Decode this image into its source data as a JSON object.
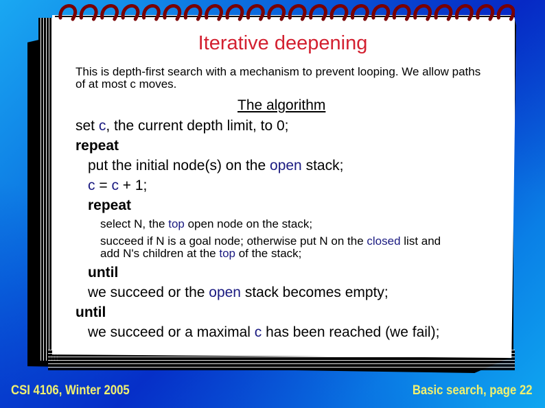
{
  "slide": {
    "title": "Iterative deepening",
    "intro": "This is depth-first search with a mechanism to prevent looping. We allow paths of at most c moves.",
    "subheading": "The algorithm",
    "algorithm": {
      "l1": {
        "a": "set ",
        "b": "c",
        "c": ", the current depth limit, to 0;"
      },
      "l2": "repeat",
      "l3": {
        "a": "put the initial node(s) on the ",
        "b": "open",
        "c": " stack;"
      },
      "l4": {
        "a": "c",
        "b": " = ",
        "c": "c",
        "d": " + 1;"
      },
      "l5": "repeat",
      "l6": {
        "a": "select N, the ",
        "b": "top",
        "c": " open node on the stack;"
      },
      "l7": {
        "a": "succeed if N is a goal node; otherwise put N on the ",
        "b": "closed",
        "c": " list and"
      },
      "l8": {
        "a": "add N's children at the ",
        "b": "top",
        "c": " of the stack;"
      },
      "l9": "until",
      "l10": {
        "a": "we succeed or the ",
        "b": "open",
        "c": " stack becomes empty;"
      },
      "l11": "until",
      "l12": {
        "a": "we succeed or a maximal ",
        "b": "c",
        "c": " has been reached (we fail);"
      }
    }
  },
  "footer": {
    "left": "CSI 4106, Winter 2005",
    "right": "Basic search, page 22"
  },
  "colors": {
    "title": "#d32030",
    "highlight": "#1a1a80",
    "footer": "#f0f070",
    "spiral": "#7a0000"
  }
}
